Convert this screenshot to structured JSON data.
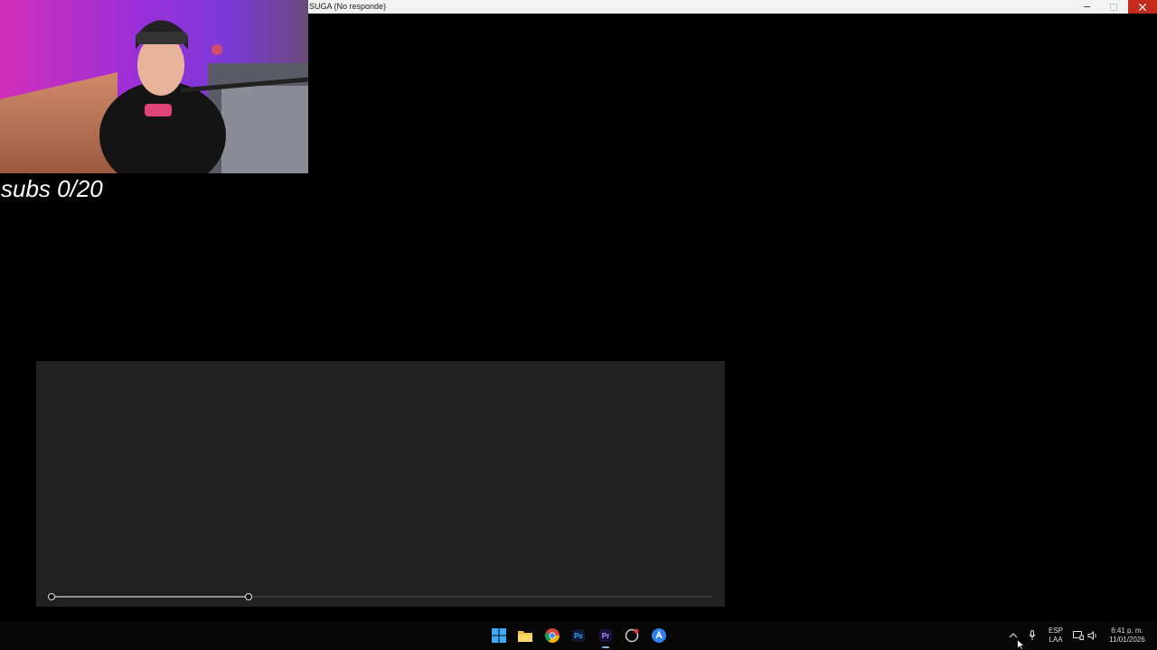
{
  "window": {
    "title": "SUGA (No responde)"
  },
  "overlay": {
    "subs_text": "subs 0/20"
  },
  "webcam": {
    "description_icon": "webcam-feed"
  },
  "slider": {
    "start_fraction": 0.0,
    "end_fraction": 0.3
  },
  "taskbar": {
    "icons": [
      "windows-start-icon",
      "file-explorer-icon",
      "chrome-icon",
      "photoshop-icon",
      "premiere-icon",
      "recording-app-icon",
      "app-icon"
    ],
    "ps_label": "Ps",
    "pr_label": "Pr",
    "lang_line1": "ESP",
    "lang_line2": "LAA",
    "time": "6:41 p. m.",
    "date": "11/01/2026"
  },
  "colors": {
    "close_button": "#c42b1c",
    "panel": "#212121",
    "taskbar": "#070707"
  }
}
